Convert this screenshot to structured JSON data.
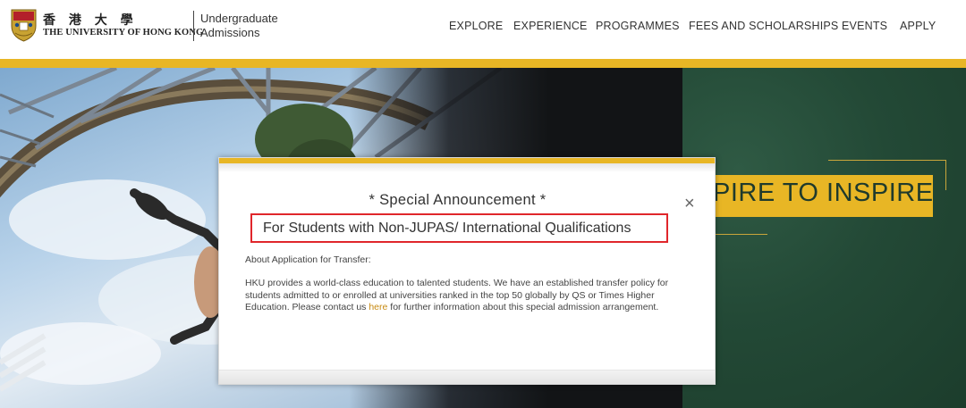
{
  "header": {
    "logo_cn": "香 港 大 學",
    "logo_en": "THE UNIVERSITY OF HONG KONG",
    "site_name_line1": "Undergraduate",
    "site_name_line2": "Admissions",
    "accent_color": "#e8b625"
  },
  "nav": {
    "items": [
      {
        "label": "EXPLORE"
      },
      {
        "label": "EXPERIENCE"
      },
      {
        "label": "PROGRAMMES"
      },
      {
        "label": "FEES AND SCHOLARSHIPS"
      },
      {
        "label": "EVENTS"
      },
      {
        "label": "APPLY"
      }
    ]
  },
  "hero": {
    "tagline": "PIRE TO INSPIRE",
    "panel_color": "#234936"
  },
  "modal": {
    "close_icon": "×",
    "title": "* Special Announcement *",
    "subtitle": "For Students with Non-JUPAS/ International Qualifications",
    "label": "About Application for Transfer:",
    "body_before_link": "HKU provides a world-class education to talented students. We have an established transfer policy for students admitted to or enrolled at universities ranked in the top 50 globally by QS or Times Higher Education. Please contact us ",
    "link_text": "here",
    "body_after_link": " for further information about this special admission arrangement.",
    "highlight_color": "#e0262b"
  }
}
